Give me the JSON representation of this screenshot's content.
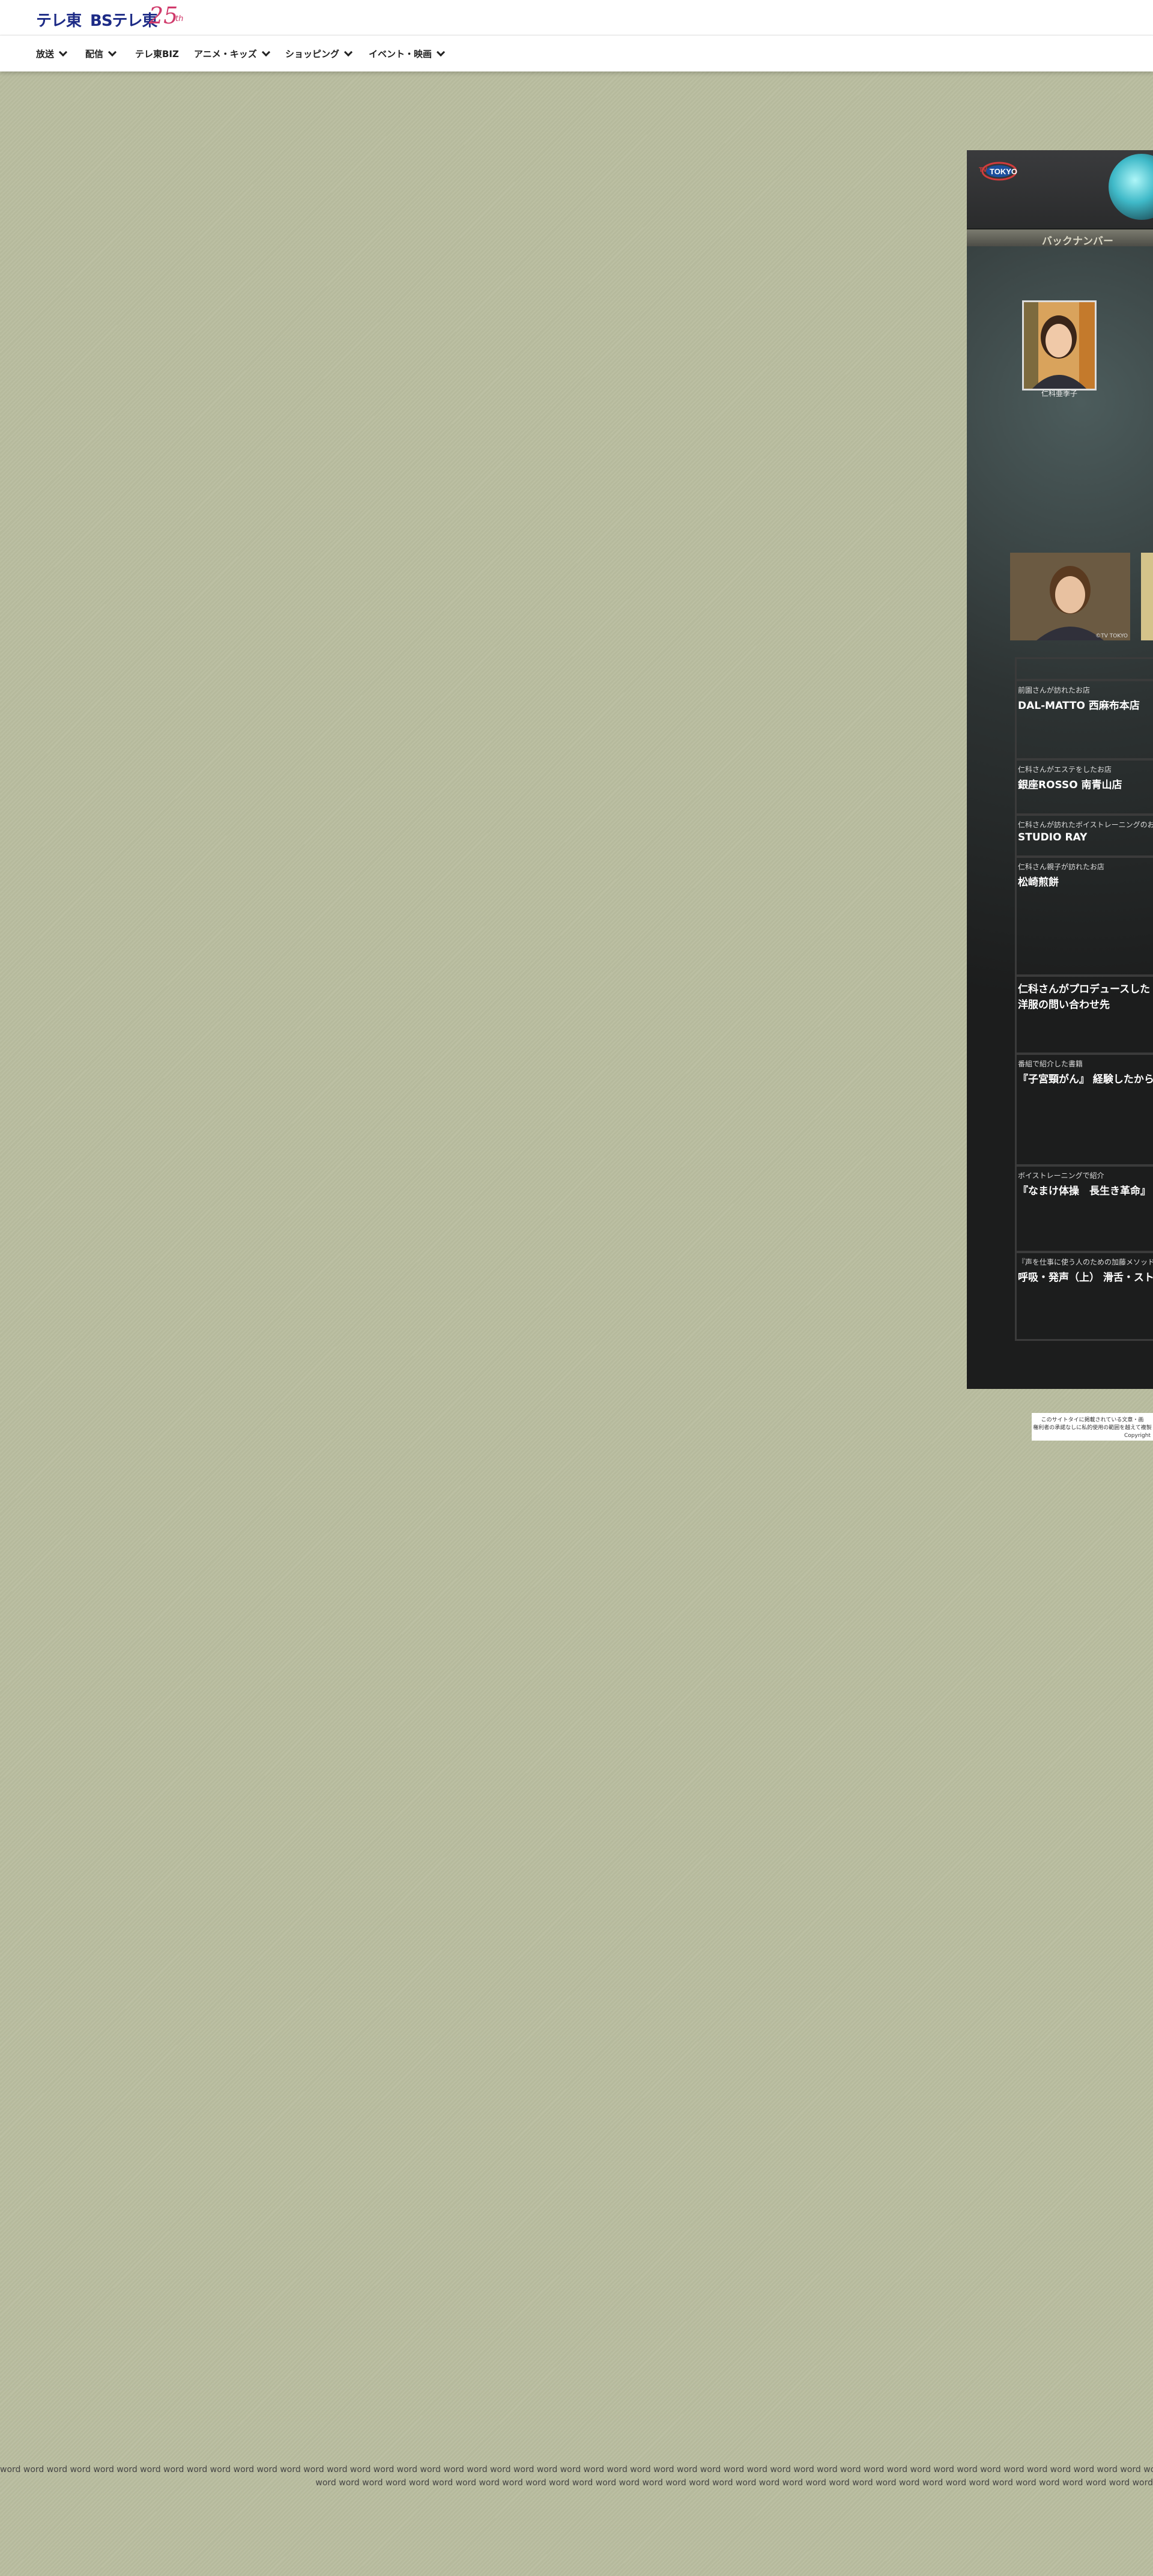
{
  "header": {
    "logo_tx": "テレ東",
    "logo_bs": "BSテレ東",
    "logo_25": "25",
    "logo_th": "th"
  },
  "nav": {
    "items": [
      {
        "label": "放送",
        "has_dropdown": true
      },
      {
        "label": "配信",
        "has_dropdown": true
      },
      {
        "label": "テレ東BIZ",
        "has_dropdown": false
      },
      {
        "label": "アニメ・キッズ",
        "has_dropdown": true
      },
      {
        "label": "ショッピング",
        "has_dropdown": true
      },
      {
        "label": "イベント・映画",
        "has_dropdown": true
      }
    ]
  },
  "panel": {
    "backnumber": "バックナンバー",
    "portrait_caption": "仁科亜季子",
    "photo_copyright": "©TV TOKYO",
    "entries": [
      {
        "sub": "前園さんが訪れたお店",
        "title": "DAL-MATTO 西麻布本店"
      },
      {
        "sub": "仁科さんがエステをしたお店",
        "title": "銀座ROSSO 南青山店"
      },
      {
        "sub": "仁科さんが訪れたボイストレーニングのお",
        "title": "STUDIO RAY"
      },
      {
        "sub": "仁科さん親子が訪れたお店",
        "title": "松崎煎餅"
      },
      {
        "sub": "",
        "title": "仁科さんがプロデュースした\n洋服の問い合わせ先"
      },
      {
        "sub": "番組で紹介した書籍",
        "title": "『子宮頸がん』 経験したからこ"
      },
      {
        "sub": "ボイストレーニングで紹介",
        "title": "『なまけ体操　長生き革命』"
      },
      {
        "sub": "『声を仕事に使う人のための加藤メソッド",
        "title": "呼吸・発声（上） 滑舌・ストレ・"
      }
    ]
  },
  "footer": {
    "line1": "このサイトタイに掲載されている文章・画",
    "line2": "権利者の承諾なしに私的使用の範囲を越えて複製",
    "line3": "Copyright"
  },
  "filler": {
    "line1": "word word word word word word word word word word word word word word word word word word word word word word word word word word word word word word word word word word word word word word word word word word word word word word word word word word word word word word word word word word word word word",
    "line2": "word word word word word word word word word word word word word word word word word word word word word word word word word word word word word word word word word word word word"
  },
  "colors": {
    "page_bg": "#b9bd9f",
    "brand_blue": "#1d2b86",
    "brand_pink": "#d03a6b",
    "panel_bg": "#1c1d1d"
  }
}
